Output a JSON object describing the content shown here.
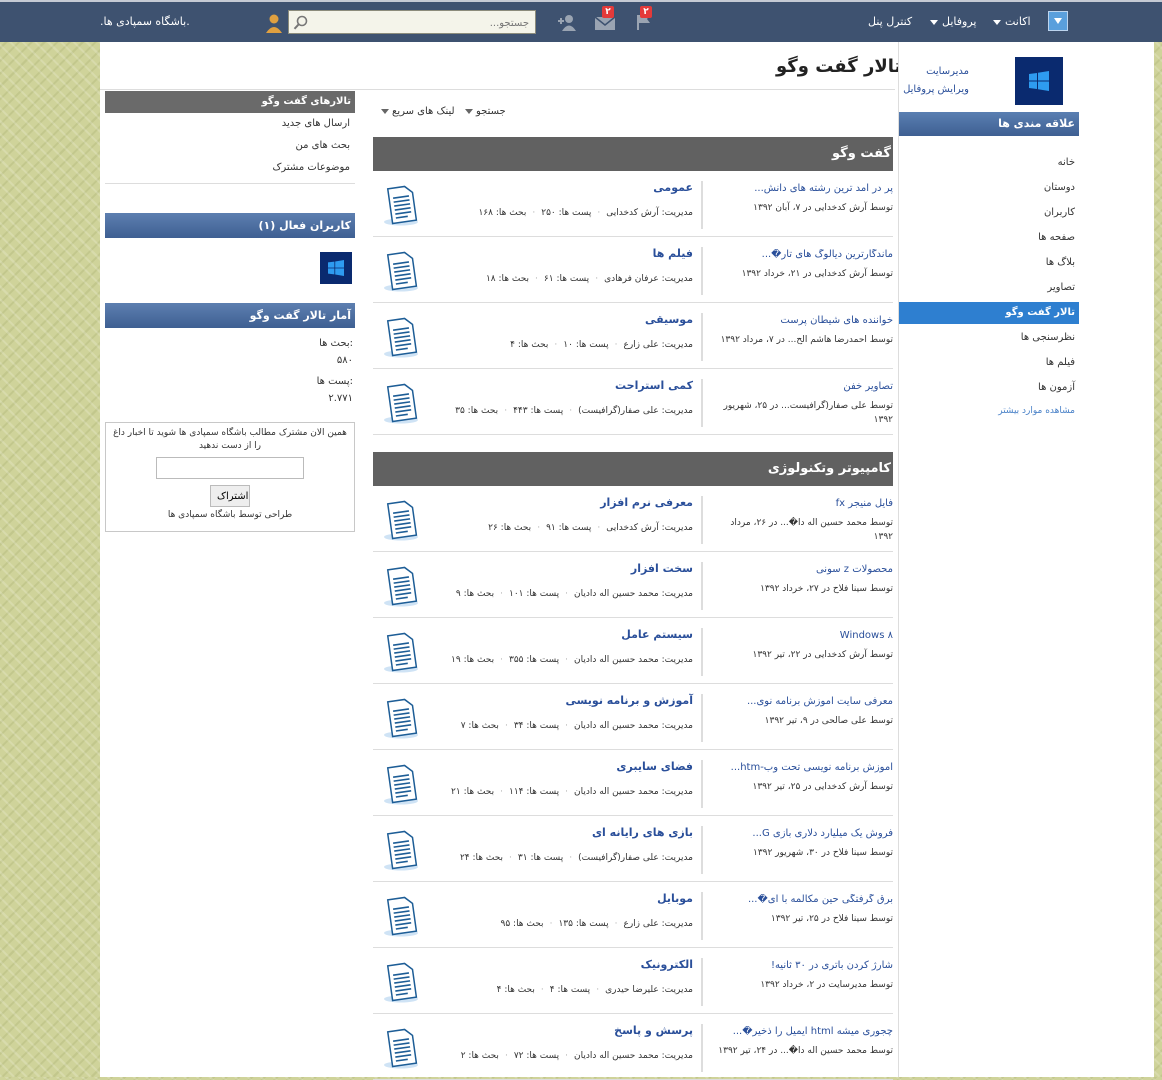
{
  "topbar": {
    "menu_account": "اکانت",
    "menu_profile": "پروفایل",
    "menu_control_panel": "کنترل پنل",
    "flag_badge": "۲",
    "mail_badge": "۲",
    "search_placeholder": "جستجو...",
    "site_name": ".باشگاه سمپادی ها."
  },
  "page": {
    "title": "تالار گفت وگو"
  },
  "user": {
    "name": "مدیرسایت",
    "edit_profile": "ویرایش پروفایل"
  },
  "sidebar": {
    "heading": "علاقه مندی ها",
    "items": [
      {
        "label": "خانه"
      },
      {
        "label": "دوستان"
      },
      {
        "label": "کاربران"
      },
      {
        "label": "صفحه ها"
      },
      {
        "label": "بلاگ ها"
      },
      {
        "label": "تصاویر"
      },
      {
        "label": "تالار گفت وگو"
      },
      {
        "label": "نظرسنجی ها"
      },
      {
        "label": "فیلم ها"
      },
      {
        "label": "آزمون ها"
      }
    ],
    "more": "مشاهده موارد بیشتر"
  },
  "left": {
    "forums_heading": "تالارهای گفت وگو",
    "links": [
      "ارسال های جدید",
      "بحث های من",
      "موضوعات مشترک"
    ],
    "active_users_heading": "کاربران فعال (۱)",
    "stats_heading": "آمار تالار گفت وگو",
    "threads_label": "بحث ها:",
    "threads_value": "۵۸۰",
    "posts_label": "پست ها:",
    "posts_value": "۲.۷۷۱",
    "subscribe_text": "همین الان مشترک مطالب باشگاه سمپادی ها شوید تا اخبار داغ را از دست ندهید",
    "subscribe_button": "اشتراک",
    "subscribe_credit": "طراحی توسط باشگاه سمپادی ها"
  },
  "toolbar": {
    "search": "جستجو",
    "quick_links": "لینک های سریع"
  },
  "sections": [
    {
      "title": "گفت وگو",
      "forums": [
        {
          "name": "عمومی",
          "moderator": "مدیریت: آرش کدخدایی",
          "posts": "پست ها: ۲۵۰",
          "threads": "بحث ها: ۱۶۸",
          "last_title": "پر در آمد ترین رشته های دانش...",
          "last_meta": "توسط آرش کدخدایی در ۷، آبان ۱۳۹۲"
        },
        {
          "name": "فیلم ها",
          "moderator": "مدیریت: عرفان فرهادی",
          "posts": "پست ها: ۶۱",
          "threads": "بحث ها: ۱۸",
          "last_title": "ماندگارترین دیالوگ های تار�...",
          "last_meta": "توسط آرش کدخدایی در ۲۱، خرداد ۱۳۹۲"
        },
        {
          "name": "موسیقی",
          "moderator": "مدیریت: علی زارع",
          "posts": "پست ها: ۱۰",
          "threads": "بحث ها: ۴",
          "last_title": "خواننده های شیطان پرست",
          "last_meta": "توسط احمدرضا هاشم الح... در ۷، مرداد ۱۳۹۲"
        },
        {
          "name": "کمی استراحت",
          "moderator": "مدیریت: علی صفار(گرافیست)",
          "posts": "پست ها: ۴۴۳",
          "threads": "بحث ها: ۳۵",
          "last_title": "تصاویر خفن",
          "last_meta": "توسط علی صفار(گرافیست... در ۲۵، شهریور ۱۳۹۲"
        }
      ]
    },
    {
      "title": "کامپیوتر وتکنولوژی",
      "forums": [
        {
          "name": "معرفی نرم افزار",
          "moderator": "مدیریت: آرش کدخدایی",
          "posts": "پست ها: ۹۱",
          "threads": "بحث ها: ۲۶",
          "last_title": "فایل منیجر fx",
          "last_meta": "توسط محمد حسین اله دا�... در ۲۶، مرداد ۱۳۹۲"
        },
        {
          "name": "سخت افزار",
          "moderator": "مدیریت: محمد حسین اله دادیان",
          "posts": "پست ها: ۱۰۱",
          "threads": "بحث ها: ۹",
          "last_title": "محصولات z سونی",
          "last_meta": "توسط سینا فلاح در ۲۷، خرداد ۱۳۹۲"
        },
        {
          "name": "سیستم عامل",
          "moderator": "مدیریت: محمد حسین اله دادیان",
          "posts": "پست ها: ۳۵۵",
          "threads": "بحث ها: ۱۹",
          "last_title": "Windows ۸",
          "last_meta": "توسط آرش کدخدایی در ۲۲، تیر ۱۳۹۲"
        },
        {
          "name": "آموزش و برنامه نویسی",
          "moderator": "مدیریت: محمد حسین اله دادیان",
          "posts": "پست ها: ۳۴",
          "threads": "بحث ها: ۷",
          "last_title": "معرفی سایت آموزش برنامه نوی...",
          "last_meta": "توسط علی صالحی در ۹، تیر ۱۳۹۲"
        },
        {
          "name": "فضای سایبری",
          "moderator": "مدیریت: محمد حسین اله دادیان",
          "posts": "پست ها: ۱۱۴",
          "threads": "بحث ها: ۲۱",
          "last_title": "آموزش برنامه نویسی تحت وب-htm...",
          "last_meta": "توسط آرش کدخدایی در ۲۵، تیر ۱۳۹۲"
        },
        {
          "name": "بازی های رایانه ای",
          "moderator": "مدیریت: علی صفار(گرافیست)",
          "posts": "پست ها: ۳۱",
          "threads": "بحث ها: ۲۴",
          "last_title": "فروش یک میلیارد دلاری بازی G...",
          "last_meta": "توسط سینا فلاح در ۳۰، شهریور ۱۳۹۲"
        },
        {
          "name": "موبایل",
          "moderator": "مدیریت: علی زارع",
          "posts": "پست ها: ۱۳۵",
          "threads": "بحث ها: ۹۵",
          "last_title": "برق گرفتگی حین مکالمه با آی�...",
          "last_meta": "توسط سینا فلاح در ۲۵، تیر ۱۳۹۲"
        },
        {
          "name": "الکترونیک",
          "moderator": "مدیریت: علیرضا حیدری",
          "posts": "پست ها: ۴",
          "threads": "بحث ها: ۴",
          "last_title": "شارژ کردن باتری در ۳۰ ثانیه!",
          "last_meta": "توسط مدیرسایت در ۲، خرداد ۱۳۹۲"
        },
        {
          "name": "پرسش و پاسخ",
          "moderator": "مدیریت: محمد حسین اله دادیان",
          "posts": "پست ها: ۷۲",
          "threads": "بحث ها: ۲",
          "last_title": "چجوری میشه html ایمیل را ذخیر�...",
          "last_meta": "توسط محمد حسین اله دا�... در ۲۴، تیر ۱۳۹۲"
        }
      ]
    }
  ]
}
